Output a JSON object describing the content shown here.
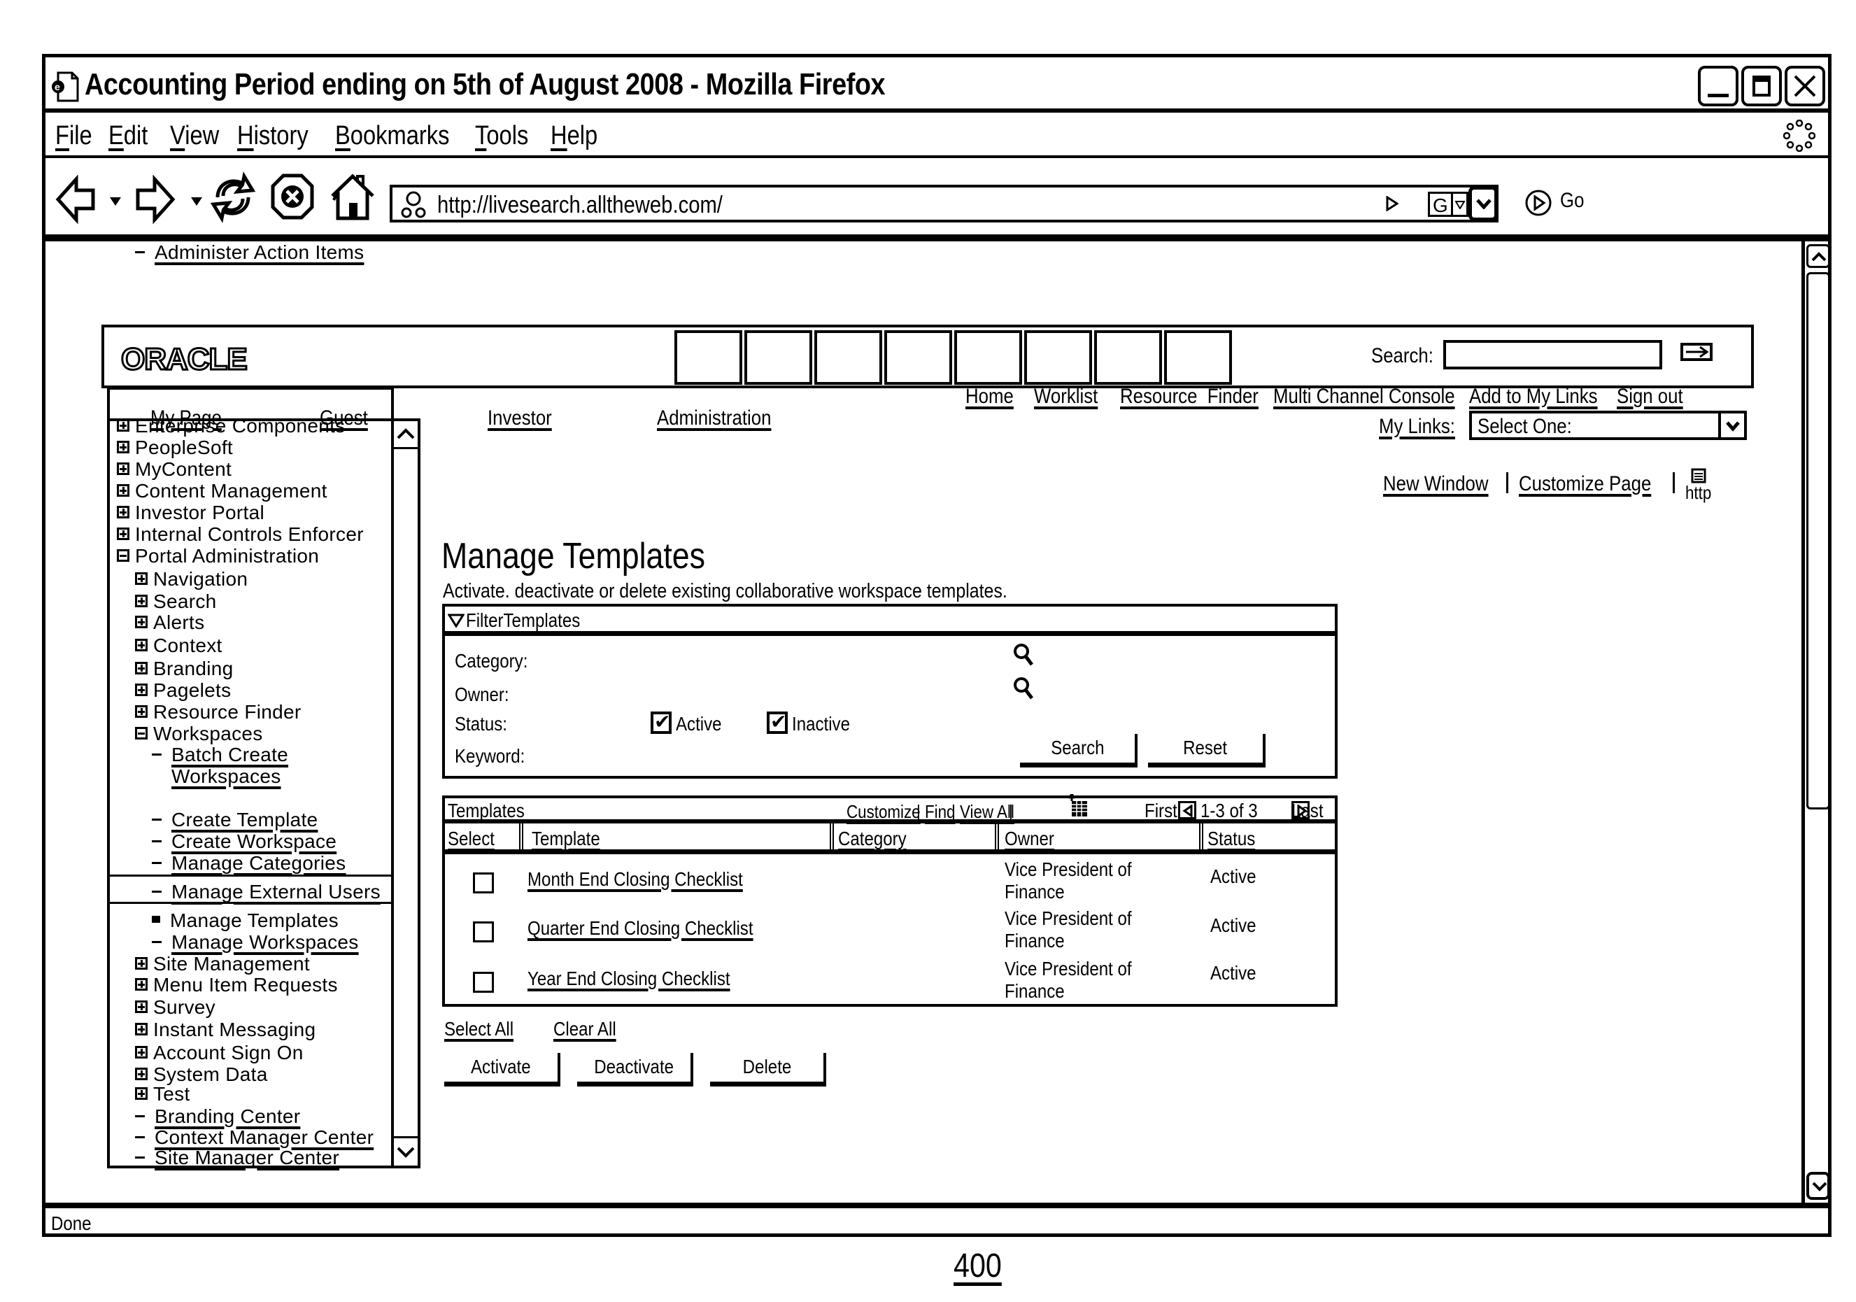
{
  "window": {
    "title": "Accounting Period ending on 5th of August 2008 - Mozilla Firefox",
    "controls": [
      "minimize",
      "maximize",
      "close"
    ]
  },
  "menu": {
    "items": [
      {
        "label": "File",
        "accel": "F",
        "rest": "ile"
      },
      {
        "label": "Edit",
        "accel": "E",
        "rest": "dit"
      },
      {
        "label": "View",
        "accel": "V",
        "rest": "iew"
      },
      {
        "label": "History",
        "accel": "H",
        "rest": "istory"
      },
      {
        "label": "Bookmarks",
        "accel": "B",
        "rest": "ookmarks"
      },
      {
        "label": "Tools",
        "accel": "T",
        "rest": "ools"
      },
      {
        "label": "Help",
        "accel": "H",
        "rest": "elp"
      }
    ]
  },
  "toolbar": {
    "url": "http://livesearch.alltheweb.com/",
    "search_engine": "G",
    "go_label": "Go"
  },
  "portal": {
    "logo": "ORACLE",
    "search_label": "Search:",
    "search_value": "",
    "nav_tabs": [
      "My Page",
      "Guest",
      "Investor",
      "Administration"
    ],
    "top_links": [
      "Home",
      "Worklist",
      "Resource  Finder",
      "Multi Channel Console",
      "Add to My Links",
      "Sign out"
    ],
    "my_links_label": "My Links:",
    "my_links_selected": "Select One:",
    "page_actions": [
      "New Window",
      "Customize Page"
    ],
    "http_icon_label": "http"
  },
  "tree": {
    "items": [
      {
        "label": "Enterprise Components",
        "type": "plus",
        "level": 0
      },
      {
        "label": "PeopleSoft",
        "type": "plus",
        "level": 0
      },
      {
        "label": "MyContent",
        "type": "plus",
        "level": 0
      },
      {
        "label": "Content Management",
        "type": "plus",
        "level": 0
      },
      {
        "label": "Investor Portal",
        "type": "plus",
        "level": 0
      },
      {
        "label": "Internal Controls Enforcer",
        "type": "plus",
        "level": 0
      },
      {
        "label": "Portal Administration",
        "type": "minus",
        "level": 0
      },
      {
        "label": "Navigation",
        "type": "plus",
        "level": 1
      },
      {
        "label": "Search",
        "type": "plus",
        "level": 1
      },
      {
        "label": "Alerts",
        "type": "plus",
        "level": 1
      },
      {
        "label": "Context",
        "type": "plus",
        "level": 1
      },
      {
        "label": "Branding",
        "type": "plus",
        "level": 1
      },
      {
        "label": "Pagelets",
        "type": "plus",
        "level": 1
      },
      {
        "label": "Resource Finder",
        "type": "plus",
        "level": 1
      },
      {
        "label": "Workspaces",
        "type": "minus",
        "level": 1
      },
      {
        "label": "Batch Create",
        "label2": "Workspaces",
        "type": "link",
        "level": 2
      },
      {
        "label": "Create Template",
        "type": "link",
        "level": 2
      },
      {
        "label": "Create Workspace",
        "type": "link",
        "level": 2
      },
      {
        "label": "Manage Categories",
        "type": "link",
        "level": 2
      },
      {
        "label": "Manage External Users",
        "type": "link",
        "level": 2
      },
      {
        "label": "Manage Templates",
        "type": "selected",
        "level": 2
      },
      {
        "label": "Manage Workspaces",
        "type": "link",
        "level": 2
      },
      {
        "label": "Site Management",
        "type": "plus",
        "level": 1
      },
      {
        "label": "Menu Item Requests",
        "type": "plus",
        "level": 1
      },
      {
        "label": "Survey",
        "type": "plus",
        "level": 1
      },
      {
        "label": "Instant Messaging",
        "type": "plus",
        "level": 1
      },
      {
        "label": "Account Sign On",
        "type": "plus",
        "level": 1
      },
      {
        "label": "System Data",
        "type": "plus",
        "level": 1
      },
      {
        "label": "Test",
        "type": "plus",
        "level": 1
      },
      {
        "label": "Branding Center",
        "type": "link",
        "level": 1
      },
      {
        "label": "Context Manager Center",
        "type": "link",
        "level": 1
      },
      {
        "label": "Site Manager Center",
        "type": "link",
        "level": 1
      },
      {
        "label": "Administer Action Items",
        "type": "link",
        "level": 1
      }
    ]
  },
  "main": {
    "title": "Manage Templates",
    "description": "Activate. deactivate or delete existing collaborative workspace templates.",
    "filter": {
      "title": "FilterTemplates",
      "category_label": "Category:",
      "owner_label": "Owner:",
      "status_label": "Status:",
      "keyword_label": "Keyword:",
      "status_active_label": "Active",
      "status_active_checked": true,
      "status_inactive_label": "Inactive",
      "status_inactive_checked": true,
      "search_button": "Search",
      "reset_button": "Reset"
    },
    "table": {
      "title": "Templates",
      "customize": "Customize",
      "find": "Find",
      "view_all": "View All",
      "first": "First",
      "range": "1-3 of 3",
      "last": "Last",
      "columns": [
        "Select",
        "Template",
        "Category",
        "Owner",
        "Status"
      ],
      "rows": [
        {
          "selected": false,
          "template": "Month End Closing Checklist",
          "category": "",
          "owner_line1": "Vice President of",
          "owner_line2": "Finance",
          "status": "Active"
        },
        {
          "selected": false,
          "template": "Quarter End Closing Checklist",
          "category": "",
          "owner_line1": "Vice President of",
          "owner_line2": "Finance",
          "status": "Active"
        },
        {
          "selected": false,
          "template": "Year End Closing Checklist",
          "category": "",
          "owner_line1": "Vice President of",
          "owner_line2": "Finance",
          "status": "Active"
        }
      ]
    },
    "select_all": "Select All",
    "clear_all": "Clear All",
    "actions": [
      "Activate",
      "Deactivate",
      "Delete"
    ]
  },
  "status_bar": {
    "text": "Done"
  },
  "figure_label": "400"
}
